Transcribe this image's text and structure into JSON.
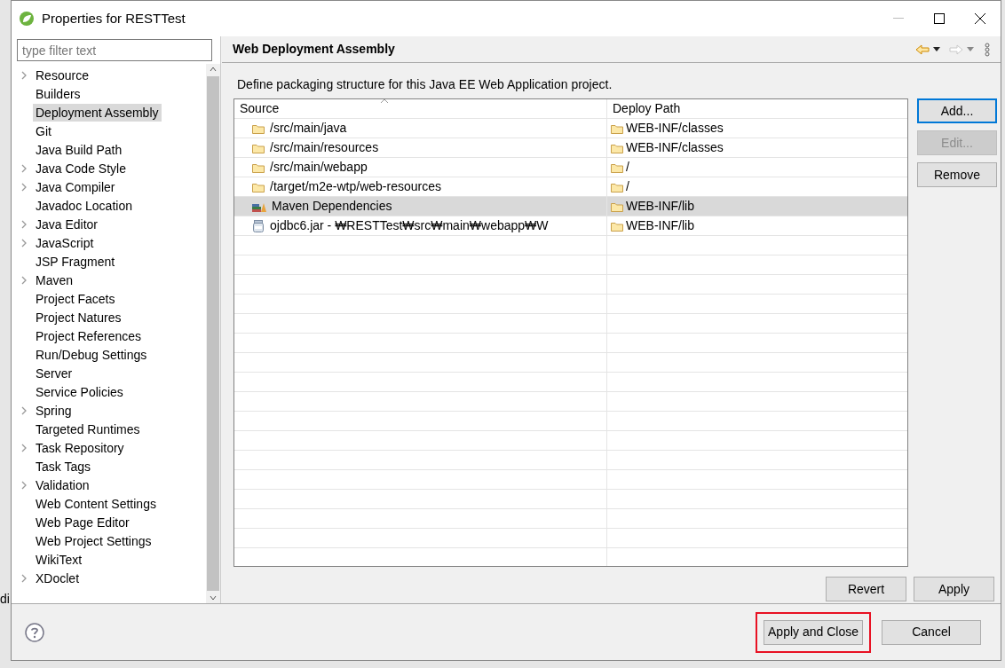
{
  "background_text": "di",
  "window": {
    "title": "Properties for RESTTest"
  },
  "filter": {
    "placeholder": "type filter text"
  },
  "sidebar": {
    "items": [
      {
        "label": "Resource",
        "expandable": true,
        "selected": false
      },
      {
        "label": "Builders",
        "expandable": false,
        "selected": false
      },
      {
        "label": "Deployment Assembly",
        "expandable": false,
        "selected": true
      },
      {
        "label": "Git",
        "expandable": false,
        "selected": false
      },
      {
        "label": "Java Build Path",
        "expandable": false,
        "selected": false
      },
      {
        "label": "Java Code Style",
        "expandable": true,
        "selected": false
      },
      {
        "label": "Java Compiler",
        "expandable": true,
        "selected": false
      },
      {
        "label": "Javadoc Location",
        "expandable": false,
        "selected": false
      },
      {
        "label": "Java Editor",
        "expandable": true,
        "selected": false
      },
      {
        "label": "JavaScript",
        "expandable": true,
        "selected": false
      },
      {
        "label": "JSP Fragment",
        "expandable": false,
        "selected": false
      },
      {
        "label": "Maven",
        "expandable": true,
        "selected": false
      },
      {
        "label": "Project Facets",
        "expandable": false,
        "selected": false
      },
      {
        "label": "Project Natures",
        "expandable": false,
        "selected": false
      },
      {
        "label": "Project References",
        "expandable": false,
        "selected": false
      },
      {
        "label": "Run/Debug Settings",
        "expandable": false,
        "selected": false
      },
      {
        "label": "Server",
        "expandable": false,
        "selected": false
      },
      {
        "label": "Service Policies",
        "expandable": false,
        "selected": false
      },
      {
        "label": "Spring",
        "expandable": true,
        "selected": false
      },
      {
        "label": "Targeted Runtimes",
        "expandable": false,
        "selected": false
      },
      {
        "label": "Task Repository",
        "expandable": true,
        "selected": false
      },
      {
        "label": "Task Tags",
        "expandable": false,
        "selected": false
      },
      {
        "label": "Validation",
        "expandable": true,
        "selected": false
      },
      {
        "label": "Web Content Settings",
        "expandable": false,
        "selected": false
      },
      {
        "label": "Web Page Editor",
        "expandable": false,
        "selected": false
      },
      {
        "label": "Web Project Settings",
        "expandable": false,
        "selected": false
      },
      {
        "label": "WikiText",
        "expandable": false,
        "selected": false
      },
      {
        "label": "XDoclet",
        "expandable": true,
        "selected": false
      }
    ]
  },
  "page": {
    "title": "Web Deployment Assembly",
    "description": "Define packaging structure for this Java EE Web Application project.",
    "table": {
      "columns": [
        "Source",
        "Deploy Path"
      ],
      "rows": [
        {
          "kind": "folder",
          "source": "/src/main/java",
          "deploy_path": "WEB-INF/classes",
          "selected": false
        },
        {
          "kind": "folder",
          "source": "/src/main/resources",
          "deploy_path": "WEB-INF/classes",
          "selected": false
        },
        {
          "kind": "folder",
          "source": "/src/main/webapp",
          "deploy_path": "/",
          "selected": false
        },
        {
          "kind": "folder",
          "source": "/target/m2e-wtp/web-resources",
          "deploy_path": "/",
          "selected": false
        },
        {
          "kind": "library",
          "source": "Maven Dependencies",
          "deploy_path": "WEB-INF/lib",
          "selected": true
        },
        {
          "kind": "jar",
          "source": "ojdbc6.jar - ₩RESTTest₩src₩main₩webapp₩W",
          "deploy_path": "WEB-INF/lib",
          "selected": false
        }
      ]
    },
    "side_buttons": [
      {
        "label": "Add...",
        "focused": true,
        "disabled": false
      },
      {
        "label": "Edit...",
        "focused": false,
        "disabled": true
      },
      {
        "label": "Remove",
        "focused": false,
        "disabled": false
      }
    ],
    "bottom_buttons": [
      "Revert",
      "Apply"
    ]
  },
  "footer_buttons": [
    {
      "label": "Apply and Close",
      "highlighted": true
    },
    {
      "label": "Cancel",
      "highlighted": false
    }
  ]
}
